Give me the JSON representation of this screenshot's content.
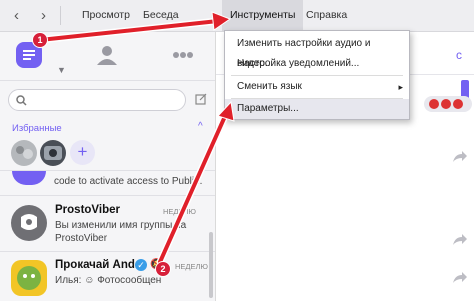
{
  "menu": {
    "tabs": [
      "Просмотр",
      "Беседа",
      "Инструменты",
      "Справка"
    ],
    "dropdown": [
      "Изменить настройки аудио и видео...",
      "Настройка уведомлений...",
      "Сменить язык",
      "Параметры..."
    ],
    "submenu_arrow": "▸"
  },
  "sidebar": {
    "favorites_label": "Избранные",
    "add_favorite": "+",
    "chats": [
      {
        "message": "code to activate access to Publi..."
      },
      {
        "name": "ProstoViber",
        "date": "НЕДЕЛЮ",
        "message_line1": "Вы изменили имя группы на",
        "message_line2": "ProstoViber"
      },
      {
        "name": "Прокачай And...",
        "date": "НЕДЕЛЮ",
        "message": "Илья: ☺ Фотосообщен"
      }
    ]
  },
  "annotations": {
    "badge1": "1",
    "badge2": "2"
  },
  "colors": {
    "accent": "#7360f2",
    "arrow": "#e0202a",
    "topbar": "#eeeef1"
  }
}
